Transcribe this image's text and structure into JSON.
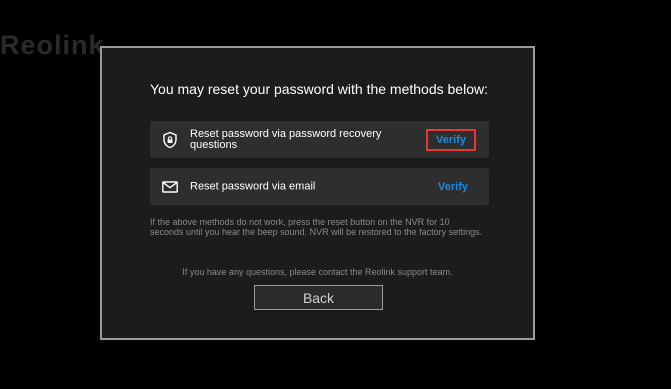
{
  "brand": {
    "logo_text": "Reolink"
  },
  "dialog": {
    "title": "You may reset your password with the methods below:",
    "options": [
      {
        "icon": "shield-lock-icon",
        "label": "Reset password via password recovery questions",
        "action": "Verify"
      },
      {
        "icon": "mail-icon",
        "label": "Reset password via email",
        "action": "Verify"
      }
    ],
    "note": "If the above methods do not work, press the reset button on the NVR for 10 seconds until you hear the beep sound. NVR will be restored to the factory settings.",
    "support_text": "If you have any questions, please contact the Reolink support team.",
    "back_label": "Back"
  },
  "colors": {
    "background": "#000000",
    "dialog_bg": "#1c1c1c",
    "option_bg": "#2e2e2e",
    "accent": "#1e88e5",
    "highlight": "#e53935"
  }
}
